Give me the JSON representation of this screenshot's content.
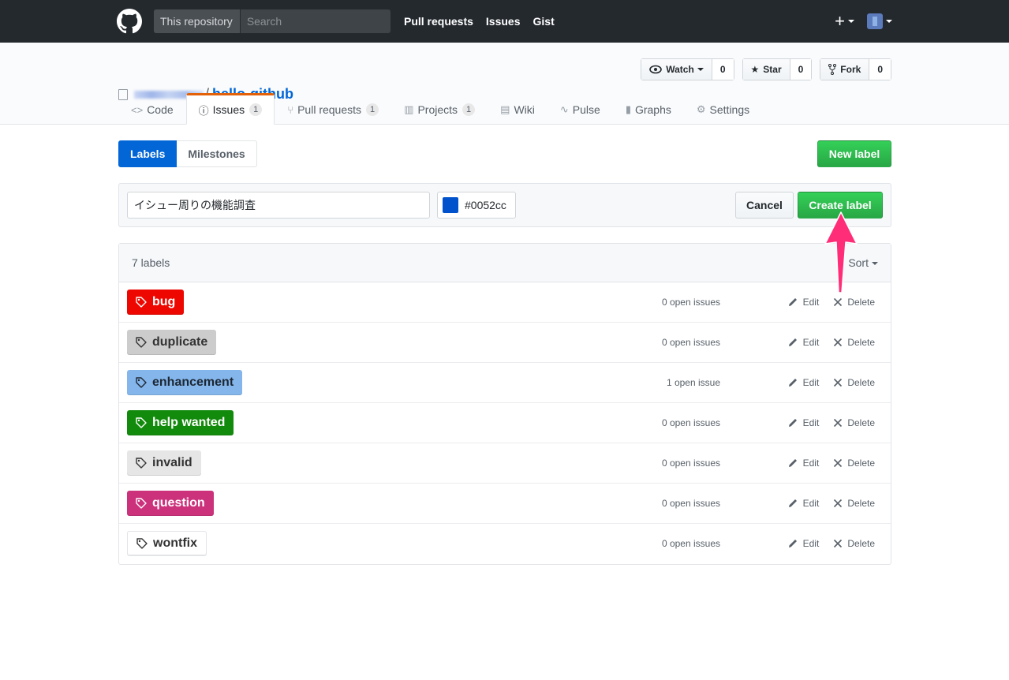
{
  "header": {
    "scope": "This repository",
    "search_placeholder": "Search",
    "nav": [
      "Pull requests",
      "Issues",
      "Gist"
    ],
    "plus": "+"
  },
  "repo": {
    "name": "hello-github",
    "slash": "/",
    "watch": {
      "label": "Watch",
      "count": "0"
    },
    "star": {
      "label": "Star",
      "count": "0"
    },
    "fork": {
      "label": "Fork",
      "count": "0"
    }
  },
  "reponav": [
    {
      "label": "Code",
      "icon": "code-icon"
    },
    {
      "label": "Issues",
      "counter": "1",
      "icon": "issue-icon"
    },
    {
      "label": "Pull requests",
      "counter": "1",
      "icon": "pr-icon"
    },
    {
      "label": "Projects",
      "counter": "1",
      "icon": "project-icon"
    },
    {
      "label": "Wiki",
      "icon": "book-icon"
    },
    {
      "label": "Pulse",
      "icon": "pulse-icon"
    },
    {
      "label": "Graphs",
      "icon": "graph-icon"
    },
    {
      "label": "Settings",
      "icon": "gear-icon"
    }
  ],
  "subnav": {
    "labels": "Labels",
    "milestones": "Milestones",
    "new_label": "New label"
  },
  "form": {
    "name_value": "イシュー周りの機能調査",
    "color_value": "#0052cc",
    "swatch_color": "#0052cc",
    "cancel": "Cancel",
    "create": "Create label"
  },
  "labels_box": {
    "count": "7 labels",
    "sort": "Sort",
    "edit": "Edit",
    "delete": "Delete",
    "rows": [
      {
        "name": "bug",
        "bg": "#ee0701",
        "fg": "#ffffff",
        "issues": "0 open issues"
      },
      {
        "name": "duplicate",
        "bg": "#cccccc",
        "fg": "#333333",
        "issues": "0 open issues"
      },
      {
        "name": "enhancement",
        "bg": "#84b6eb",
        "fg": "#1c2733",
        "issues": "1 open issue"
      },
      {
        "name": "help wanted",
        "bg": "#128a0c",
        "fg": "#ffffff",
        "issues": "0 open issues"
      },
      {
        "name": "invalid",
        "bg": "#e6e6e6",
        "fg": "#333333",
        "issues": "0 open issues"
      },
      {
        "name": "question",
        "bg": "#cc317c",
        "fg": "#ffffff",
        "issues": "0 open issues"
      },
      {
        "name": "wontfix",
        "bg": "#ffffff",
        "fg": "#333333",
        "issues": "0 open issues"
      }
    ]
  },
  "colors": {
    "accent": "#0366d6",
    "arrow": "#ff2d78",
    "selected_tab_border": "#e36209"
  }
}
